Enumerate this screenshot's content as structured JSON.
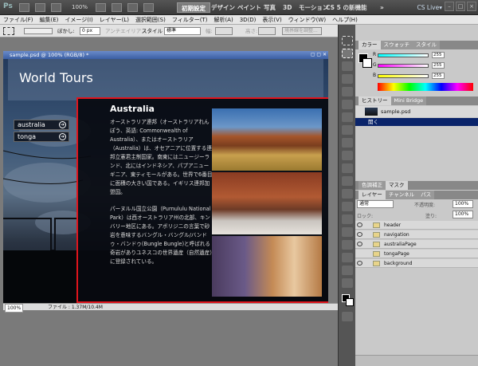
{
  "app": {
    "logo": "Ps",
    "zoom": "100%",
    "workspaces": [
      "初期設定",
      "デザイン",
      "ペイント",
      "写真",
      "3D",
      "モーション",
      "CS 5 の新機能"
    ],
    "more": "»",
    "cs_live": "CS Live▾",
    "win_min": "–",
    "win_max": "□",
    "win_close": "×"
  },
  "menu": [
    "ファイル(F)",
    "編集(E)",
    "イメージ(I)",
    "レイヤー(L)",
    "選択範囲(S)",
    "フィルター(T)",
    "解析(A)",
    "3D(D)",
    "表示(V)",
    "ウィンドウ(W)",
    "ヘルプ(H)"
  ],
  "options": {
    "feather_label": "ぼかし:",
    "feather_value": "0 px",
    "antialias": "アンチエイリアス",
    "style_label": "スタイル :",
    "style_value": "標準",
    "width_label": "幅:",
    "height_label": "高さ:",
    "refine": "境界線を調整..."
  },
  "document": {
    "tab": "sample.psd @ 100% (RGB/8) *",
    "zoom": "100%",
    "file_info": "ファイル : 1.37M/10.4M"
  },
  "site": {
    "title": "World Tours",
    "nav": [
      "australia",
      "tonga"
    ],
    "arrow": "➔",
    "heading": "Australia",
    "para1": "オーストラリア連邦（オーストラリアれんぽう、英語: Commonwealth of Australia）、またはオーストラリア（Australia）は、オセアニアに位置する連邦立憲君主制国家。南東にはニュージーランド、北にはインドネシア、パプアニューギニア、東ティモールがある。世界で6番目に面積の大きい国である。イギリス連邦加盟国。",
    "para2": "パーヌルル国立公園（Purnululu National Park）は西オーストラリア州の北部、キンバリー地区にある。アボリジニの言葉で砂岩を意味するバングル・バングル/バンドゥ・バンドゥ(Bungle Bungle)と呼ばれる奇岩がありユネスコの世界遺産（自然遺産）に登録されている。"
  },
  "panels": {
    "color_tabs": [
      "カラー",
      "スウォッチ",
      "スタイル"
    ],
    "r_label": "R",
    "g_label": "G",
    "b_label": "B",
    "r": "255",
    "g": "255",
    "b": "255",
    "history_tabs": [
      "ヒストリー",
      "Mini Bridge"
    ],
    "history_file": "sample.psd",
    "history_open": "開く",
    "adjust_tabs": [
      "色調補正",
      "マスク"
    ],
    "layer_tabs": [
      "レイヤー",
      "チャンネル",
      "パス"
    ],
    "blend": "通常",
    "opacity_label": "不透明度:",
    "opacity": "100%",
    "lock_label": "ロック:",
    "fill_label": "塗り:",
    "fill": "100%",
    "layers": [
      "header",
      "navigation",
      "australiaPage",
      "tongaPage",
      "background"
    ]
  },
  "colors": {
    "accent": "#e0141c",
    "selection": "#0a246a"
  }
}
